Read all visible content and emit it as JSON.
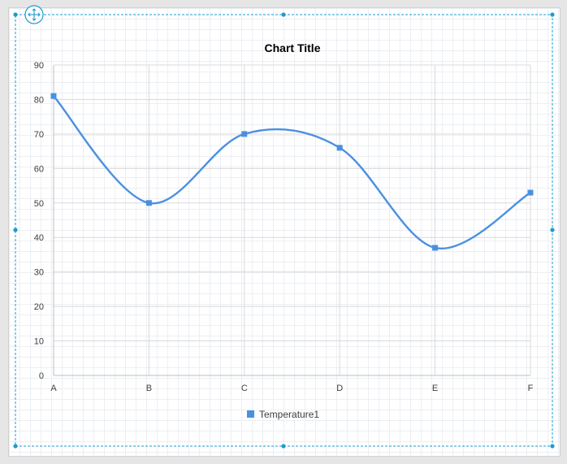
{
  "accent_color": "#1d9bd1",
  "series_color": "#4a90e2",
  "move_handle_icon": "move-arrows-icon",
  "chart_data": {
    "type": "line",
    "smooth": true,
    "title": "Chart Title",
    "xlabel": "",
    "ylabel": "",
    "categories": [
      "A",
      "B",
      "C",
      "D",
      "E",
      "F"
    ],
    "series": [
      {
        "name": "Temperature1",
        "values": [
          81,
          50,
          70,
          66,
          37,
          53
        ]
      }
    ],
    "ylim": [
      0,
      90
    ],
    "ytick_labels": [
      "0",
      "10",
      "20",
      "30",
      "40",
      "50",
      "60",
      "70",
      "80",
      "90"
    ],
    "grid": true,
    "legend_position": "bottom"
  }
}
